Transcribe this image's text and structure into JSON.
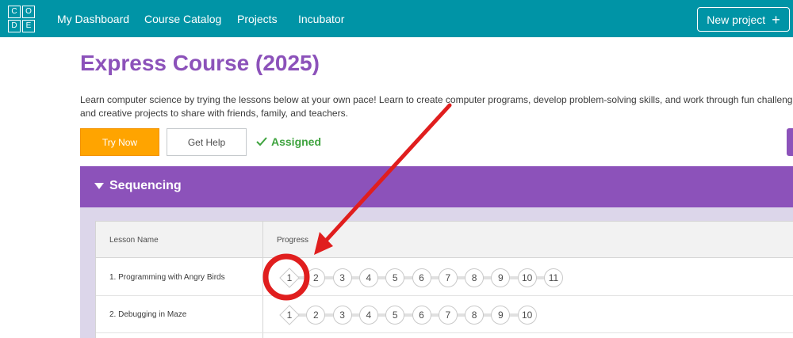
{
  "logo": {
    "letters": [
      "C",
      "O",
      "D",
      "E"
    ]
  },
  "nav": {
    "items": [
      "My Dashboard",
      "Course Catalog",
      "Projects",
      "Incubator"
    ],
    "new_project_label": "New project",
    "new_project_icon": "+"
  },
  "course": {
    "title": "Express Course (2025)",
    "description_line1": "Learn computer science by trying the lessons below at your own pace! Learn to create computer programs, develop problem-solving skills, and work through fun challenges! Mak",
    "description_line2": "and creative projects to share with friends, family, and teachers.",
    "try_now_label": "Try Now",
    "get_help_label": "Get Help",
    "assigned_label": "Assigned"
  },
  "unit": {
    "title": "Sequencing",
    "table": {
      "headers": [
        "Lesson Name",
        "Progress"
      ],
      "lessons": [
        {
          "name": "1. Programming with Angry Birds",
          "levels": [
            "1",
            "2",
            "3",
            "4",
            "5",
            "6",
            "7",
            "8",
            "9",
            "10",
            "11"
          ]
        },
        {
          "name": "2. Debugging in Maze",
          "levels": [
            "1",
            "2",
            "3",
            "4",
            "5",
            "6",
            "7",
            "8",
            "9",
            "10"
          ]
        }
      ]
    }
  },
  "colors": {
    "topbar": "#0094a6",
    "brand_purple": "#8c52ba",
    "try_now": "#ffa400",
    "assigned_green": "#3ea33e",
    "annotation_red": "#e01e1e"
  }
}
